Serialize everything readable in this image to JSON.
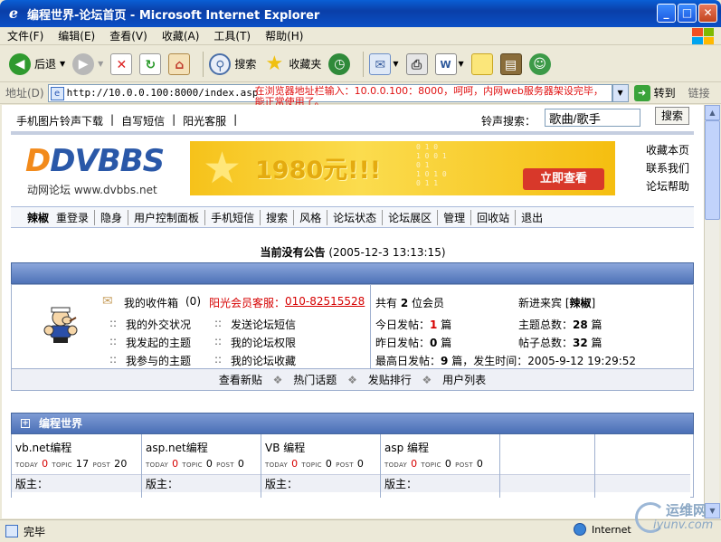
{
  "window": {
    "title": "编程世界-论坛首页 - Microsoft Internet Explorer"
  },
  "menu": [
    "文件(F)",
    "编辑(E)",
    "查看(V)",
    "收藏(A)",
    "工具(T)",
    "帮助(H)"
  ],
  "toolbar": {
    "back": "后退",
    "search": "搜索",
    "favorites": "收藏夹"
  },
  "address": {
    "label": "地址(D)",
    "url": "http://10.0.0.100:8000/index.asp",
    "note": "在浏览器地址栏输入：10.0.0.100：8000，呵呵，内网web服务器架设完毕，能正常使用了。",
    "go": "转到",
    "links": "链接"
  },
  "page": {
    "toplinks": [
      "手机图片铃声下载",
      "|",
      "自写短信",
      "|",
      "阳光客服",
      "|"
    ],
    "ring_search_label": "铃声搜索：",
    "ring_search_value": "歌曲/歌手",
    "ring_search_button": "搜索",
    "logo": {
      "main": "DVBBS",
      "sub": "动网论坛 www.dvbbs.net"
    },
    "banner": {
      "price": "1980元!!!",
      "buy": "立即查看"
    },
    "side_links": [
      "收藏本页",
      "联系我们",
      "论坛帮助"
    ],
    "nav": [
      "辣椒",
      "重登录",
      "隐身",
      "用户控制面板",
      "手机短信",
      "搜索",
      "风格",
      "论坛状态",
      "论坛展区",
      "管理",
      "回收站",
      "退出"
    ],
    "notice": {
      "text": "当前没有公告",
      "time": "(2005-12-3 13:13:15)"
    },
    "user": {
      "inbox": "我的收件箱",
      "inbox_count": "(0)",
      "service": "阳光会员客服：",
      "phone": "010-82515528",
      "links": [
        "我的外交状况",
        "发送论坛短信",
        "我发起的主题",
        "我的论坛权限",
        "我参与的主题",
        "我的论坛收藏"
      ],
      "bullet": "::"
    },
    "stats": {
      "members_pre": "共有",
      "members": "2",
      "members_post": "位会员",
      "newest_label": "新进来宾",
      "newest": "辣椒",
      "today_label": "今日发帖：",
      "today": "1",
      "unit": "篇",
      "topics_label": "主题总数：",
      "topics": "28",
      "yesterday_label": "昨日发帖：",
      "yesterday": "0",
      "posts_label": "帖子总数：",
      "posts": "32",
      "max_label": "最高日发帖：",
      "max": "9",
      "max_time_label": "，发生时间：",
      "max_time": "2005-9-12 19:29:52"
    },
    "bottom_links": [
      "查看新贴",
      "热门话题",
      "发贴排行",
      "用户列表"
    ],
    "forum_section": "编程世界",
    "forums": [
      {
        "name": "vb.net编程",
        "today": "0",
        "topic": "17",
        "post": "20"
      },
      {
        "name": "asp.net编程",
        "today": "0",
        "topic": "0",
        "post": "0"
      },
      {
        "name": "VB 编程",
        "today": "0",
        "topic": "0",
        "post": "0"
      },
      {
        "name": "asp 编程",
        "today": "0",
        "topic": "0",
        "post": "0"
      }
    ],
    "forum_labels": {
      "today": "TODAY",
      "topic": "TOPIC",
      "post": "POST",
      "mod": "版主："
    }
  },
  "status": {
    "text": "完毕",
    "zone": "Internet"
  },
  "watermark": {
    "cn": "运维网",
    "url": "iyunv.com"
  }
}
